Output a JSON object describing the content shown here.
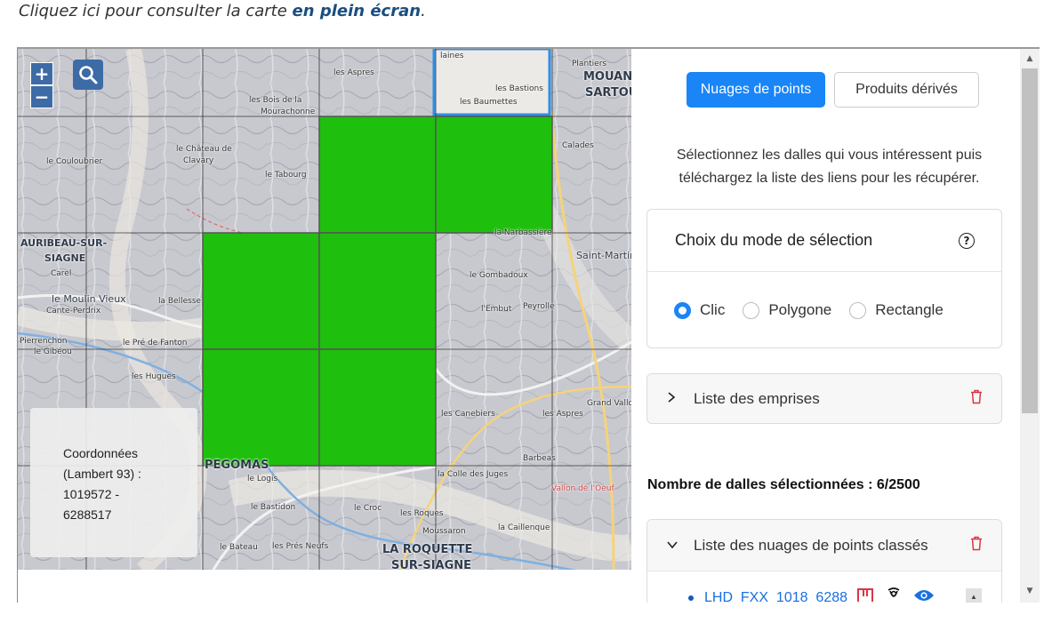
{
  "intro": {
    "text": "Cliquez ici pour consulter la carte ",
    "link": "en plein écran",
    "end": "."
  },
  "map": {
    "zoom_in": "+",
    "zoom_out": "−",
    "selected_tiles": 6,
    "labels": {
      "l1": "laines",
      "l2": "Plantiers",
      "l3": "MOUAN",
      "l4": "SARTOU",
      "l5": "les Bastions",
      "l6": "les Baumettes",
      "l7": "les Aspres",
      "l8": "les Bois de la",
      "l9": "Mourachonne",
      "l10": "le Château de",
      "l11": "Clavary",
      "l12": "le Couloubrier",
      "l13": "le Tabourg",
      "l14": "Calades",
      "l15": "la Narbassière",
      "l16": "AURIBEAU-SUR-",
      "l17": "SIAGNE",
      "l18": "Carel",
      "l19": "le Moulin Vieux",
      "l20": "Cante-Perdrix",
      "l21": "la Bellesse",
      "l22": "le Gombadoux",
      "l23": "Saint-Martin",
      "l24": "l'Embut",
      "l25": "Peyrolle",
      "l26": "Pierrenchon",
      "l27": "le Pré de Fanton",
      "l28": "le Gibéou",
      "l29": "les Hugues",
      "l30": "les Canebiers",
      "l31": "les Aspres",
      "l32": "Grand Vallon",
      "l33": "Barbeas",
      "l34": "la Colle des Juges",
      "l35": "le Logis",
      "l36": "le Bastidon",
      "l37": "le Croc",
      "l38": "les Roques",
      "l39": "la Caillenque",
      "l40": "Moussaron",
      "l41": "LA ROQUETTE",
      "l42": "SUR-SIAGNE",
      "l43": "le Bateau",
      "l44": "les Prés Neufs",
      "l45": "PEGOMAS",
      "l46": "Vallon de l'Oeuf"
    },
    "coords": {
      "line1": "Coordonnées",
      "line2": "(Lambert 93) :",
      "line3": "1019572 -",
      "line4": "6288517"
    }
  },
  "panel": {
    "tab_active": "Nuages de points",
    "tab_other": "Produits dérivés",
    "description_line1": "Sélectionnez les dalles qui vous intéressent puis",
    "description_line2": "téléchargez la liste des liens pour les récupérer.",
    "mode_title": "Choix du mode de sélection",
    "help_glyph": "?",
    "mode_options": [
      "Clic",
      "Polygone",
      "Rectangle"
    ],
    "mode_selected": "Clic",
    "emprises_label": "Liste des emprises",
    "count_label": "Nombre de dalles sélectionnées : 6/2500",
    "nuages_label": "Liste des nuages de points classés",
    "tile_link": "LHD_FXX_1018_6288"
  },
  "colors": {
    "primary": "#1a85f7",
    "selected_tile": "#1fbf0e",
    "danger": "#dc3545",
    "map_button": "#3d6ba6"
  },
  "icons": {
    "zoom": "search-icon",
    "help": "question-circle-icon",
    "trash": "trash-icon",
    "chevron_right": "chevron-right-icon",
    "chevron_down": "chevron-down-icon",
    "view": "eye-icon",
    "download": "download-icon",
    "location": "location-icon"
  }
}
